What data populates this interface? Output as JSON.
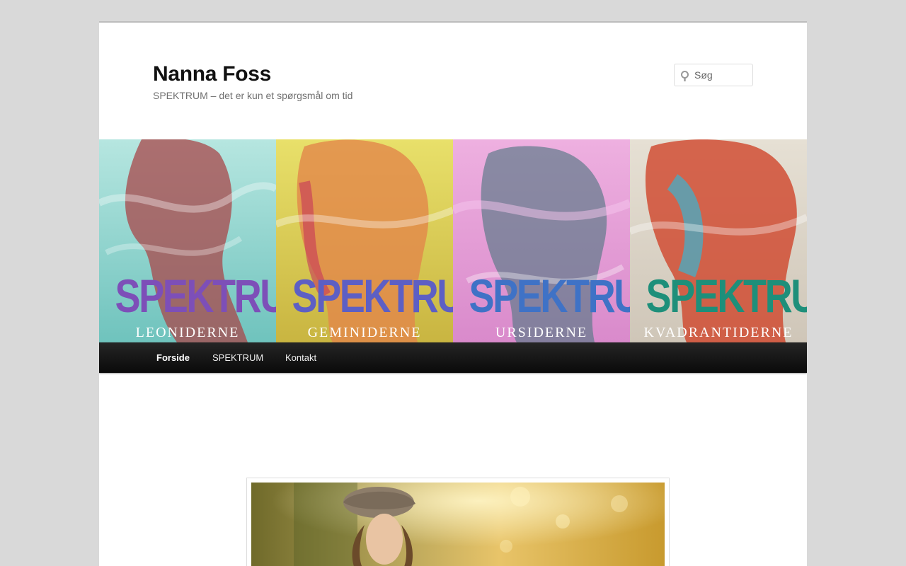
{
  "site": {
    "title": "Nanna Foss",
    "description": "SPEKTRUM – det er kun et spørgsmål om tid"
  },
  "search": {
    "placeholder": "Søg",
    "icon": "search-icon"
  },
  "banner": {
    "panels": [
      {
        "title": "SPEKTRUM",
        "subtitle": "LEONIDERNE",
        "title_color": "#7d4fb8",
        "bg": "#8fd4cf",
        "accent": "#a8474a"
      },
      {
        "title": "SPEKTRUM",
        "subtitle": "GEMINIDERNE",
        "title_color": "#5d5fc4",
        "bg": "#d9cf50",
        "accent": "#c7375a"
      },
      {
        "title": "SPEKTRUM",
        "subtitle": "URSIDERNE",
        "title_color": "#3f72c6",
        "bg": "#e59ad6",
        "accent": "#4a8a9a"
      },
      {
        "title": "SPEKTRUM",
        "subtitle": "KVADRANTIDERNE",
        "title_color": "#1e8f7a",
        "bg": "#d9d2c6",
        "accent": "#d0452a"
      }
    ]
  },
  "nav": {
    "items": [
      {
        "label": "Forside",
        "active": true
      },
      {
        "label": "SPEKTRUM",
        "active": false
      },
      {
        "label": "Kontakt",
        "active": false
      }
    ]
  },
  "colors": {
    "page_bg": "#d9d9d9",
    "content_bg": "#ffffff",
    "nav_bg": "#1a1a1a",
    "title": "#111111",
    "description": "#707070"
  }
}
